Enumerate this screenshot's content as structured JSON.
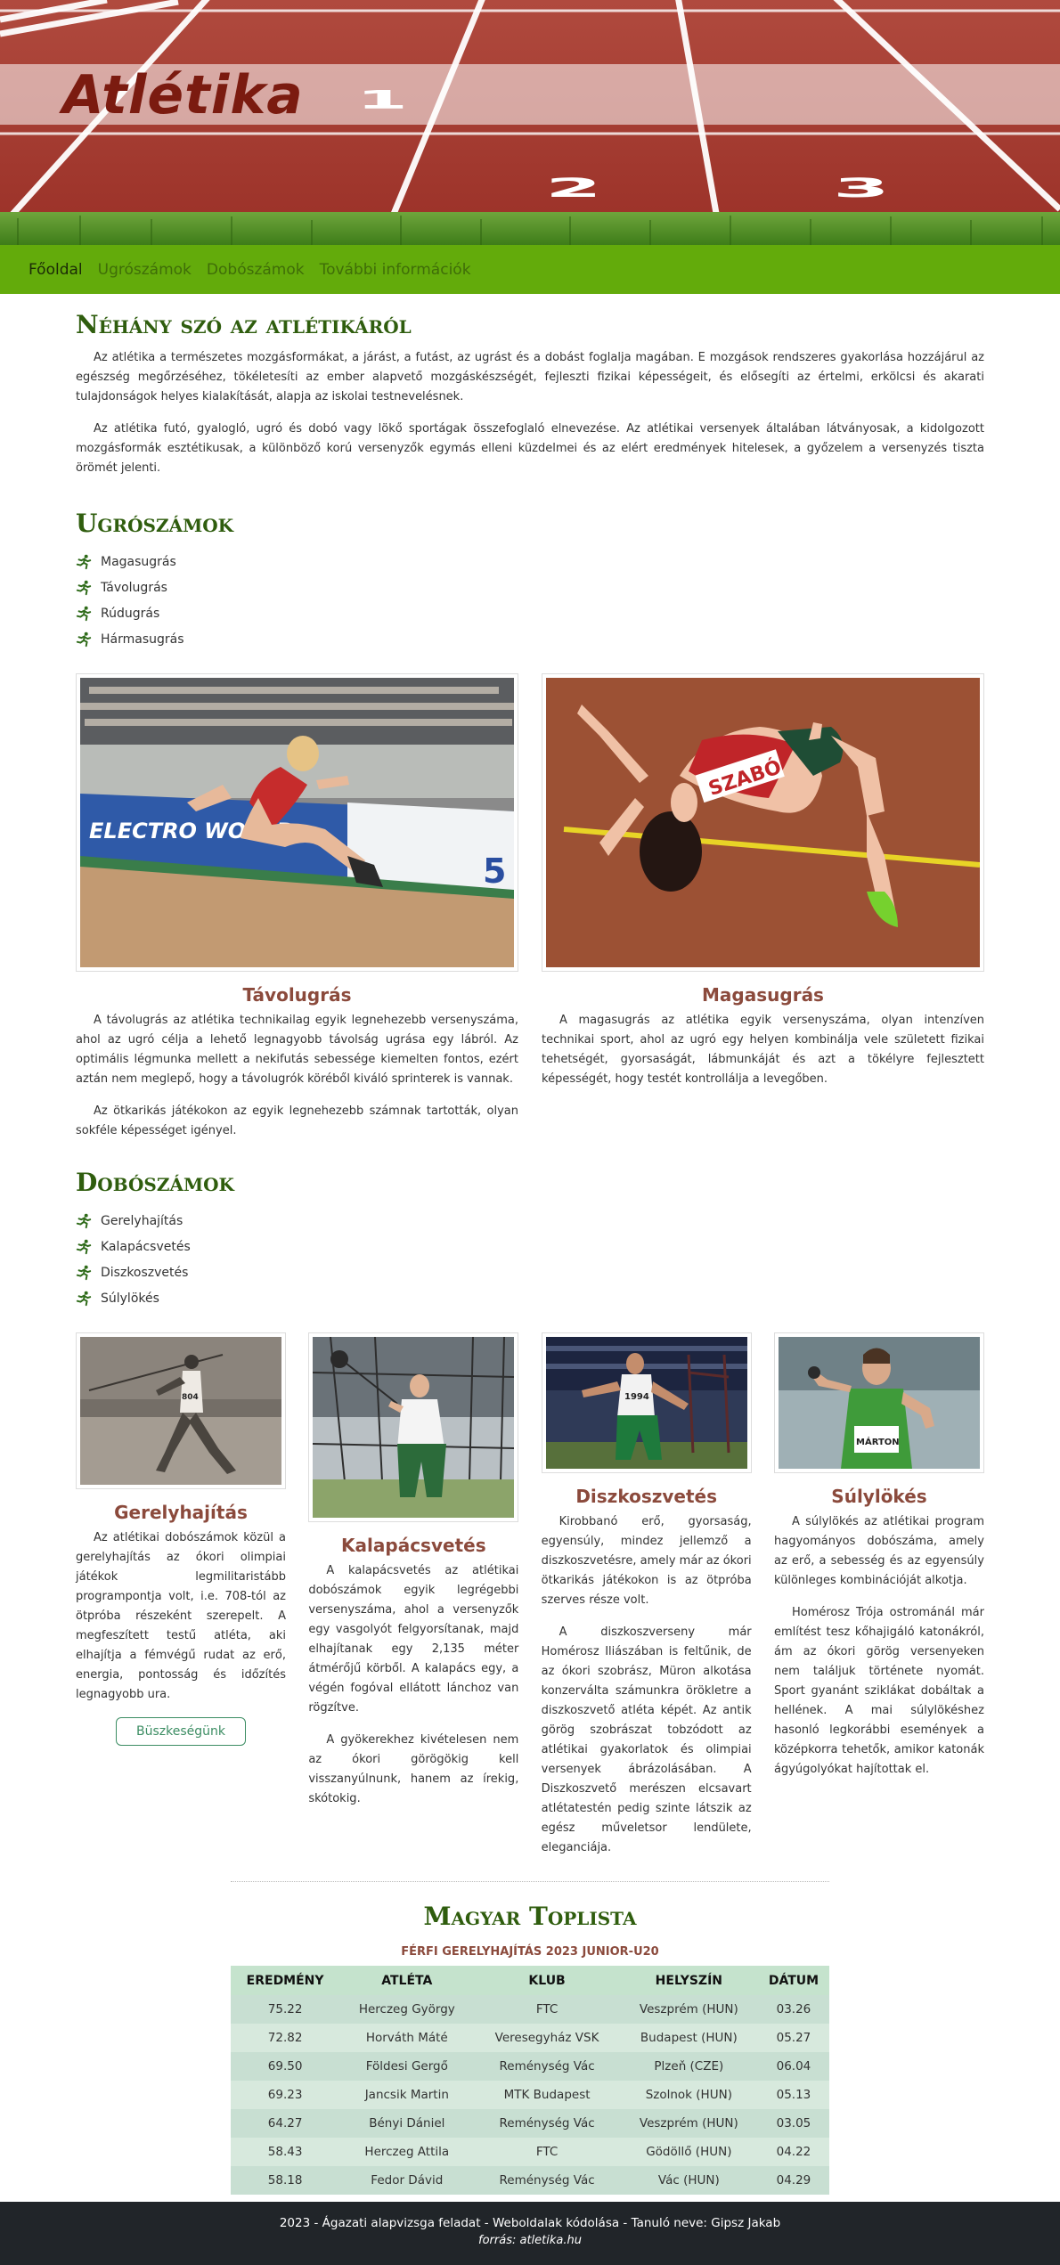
{
  "hero": {
    "title": "Atlétika",
    "lane_numbers": [
      "1",
      "2",
      "3"
    ]
  },
  "nav": {
    "items": [
      "Főoldal",
      "Ugrószámok",
      "Dobószámok",
      "További információk"
    ]
  },
  "intro": {
    "heading": "Néhány szó az atlétikáról",
    "p1": "Az atlétika a természetes mozgásformákat, a járást, a futást, az ugrást és a dobást foglalja magában. E mozgások rendszeres gyakorlása hozzájárul az egészség megőrzéséhez, tökéletesíti az ember alapvető mozgáskészségét, fejleszti fizikai képességeit, és elősegíti az értelmi, erkölcsi és akarati tulajdonságok helyes kialakítását, alapja az iskolai testnevelésnek.",
    "p2": "Az atlétika futó, gyalogló, ugró és dobó vagy lökő sportágak összefoglaló elnevezése. Az atlétikai versenyek általában látványosak, a kidolgozott mozgásformák esztétikusak, a különböző korú versenyzők egymás elleni küzdelmei és az elért eredmények hitelesek, a győzelem a versenyzés tiszta örömét jelenti."
  },
  "jumps": {
    "heading": "Ugrószámok",
    "list": [
      "Magasugrás",
      "Távolugrás",
      "Rúdugrás",
      "Hármasugrás"
    ],
    "cards": [
      {
        "title": "Távolugrás",
        "paragraphs": [
          "A távolugrás az atlétika technikailag egyik legnehezebb versenyszáma, ahol az ugró célja a lehető legnagyobb távolság ugrása egy lábról. Az optimális légmunka mellett a nekifutás sebessége kiemelten fontos, ezért aztán nem meglepő, hogy a távolugrók köréből kiváló sprinterek is vannak.",
          "Az ötkarikás játékokon az egyik legnehezebb számnak tartották, olyan sokféle képességet igényel."
        ],
        "image_text": "ELECTRO WORLD"
      },
      {
        "title": "Magasugrás",
        "paragraphs": [
          "A magasugrás az atlétika egyik versenyszáma, olyan intenzíven technikai sport, ahol az ugró egy helyen kombinálja vele született fizikai tehetségét, gyorsaságát, lábmunkáját és azt a tökélyre fejlesztett képességét, hogy testét kontrollálja a levegőben."
        ],
        "image_text": "SZABÓ"
      }
    ]
  },
  "throws": {
    "heading": "Dobószámok",
    "list": [
      "Gerelyhajítás",
      "Kalapácsvetés",
      "Diszkoszvetés",
      "Súlylökés"
    ],
    "cards": [
      {
        "title": "Gerelyhajítás",
        "paragraphs": [
          "Az atlétikai dobószámok közül a gerelyhajítás az ókori olimpiai játékok legmilitaristább programpontja volt, i.e. 708-tól az ötpróba részeként szerepelt. A megfeszített testű atléta, aki elhajítja a fémvégű rudat az erő, energia, pontosság és időzítés legnagyobb ura."
        ],
        "button": "Büszkeségünk"
      },
      {
        "title": "Kalapácsvetés",
        "paragraphs": [
          "A kalapácsvetés az atlétikai dobószámok egyik legrégebbi versenyszáma, ahol a versenyzők egy vasgolyót felgyorsítanak, majd elhajítanak egy 2,135 méter átmérőjű körből. A kalapács egy, a végén fogóval ellátott lánchoz van rögzítve.",
          "A gyökerekhez kivételesen nem az ókori görögökig kell visszanyúlnunk, hanem az írekig, skótokig."
        ]
      },
      {
        "title": "Diszkoszvetés",
        "paragraphs": [
          "Kirobbanó erő, gyorsaság, egyensúly, mindez jellemző a diszkoszvetésre, amely már az ókori ötkarikás játékokon is az ötpróba szerves része volt.",
          "A diszkoszverseny már Homérosz Iliászában is feltűnik, de az ókori szobrász, Müron alkotása konzerválta számunkra örökletre a diszkoszvető atléta képét. Az antik görög szobrászat tobzódott az atlétikai gyakorlatok és olimpiai versenyek ábrázolásában. A Diszkoszvető merészen elcsavart atlétatestén pedig szinte látszik az egész műveletsor lendülete, eleganciája."
        ],
        "image_text": "1994"
      },
      {
        "title": "Súlylökés",
        "paragraphs": [
          "A súlylökés az atlétikai program hagyományos dobószáma, amely az erő, a sebesség és az egyensúly különleges kombinációját alkotja.",
          "Homérosz Trója ostrománál már említést tesz kőhajigáló katonákról, ám az ókori görög versenyeken nem találjuk története nyomát. Sport gyanánt sziklákat dobáltak a hellének. A mai súlylökéshez hasonló legkorábbi események a középkorra tehetők, amikor katonák ágyúgolyókat hajítottak el."
        ],
        "image_text": "MÁRTON"
      }
    ]
  },
  "toplista": {
    "heading": "Magyar Toplista",
    "subtitle": "FÉRFI GERELYHAJÍTÁS 2023 JUNIOR-U20",
    "columns": [
      "EREDMÉNY",
      "ATLÉTA",
      "KLUB",
      "HELYSZÍN",
      "DÁTUM"
    ],
    "rows": [
      [
        "75.22",
        "Herczeg György",
        "FTC",
        "Veszprém (HUN)",
        "03.26"
      ],
      [
        "72.82",
        "Horváth Máté",
        "Veresegyház VSK",
        "Budapest (HUN)",
        "05.27"
      ],
      [
        "69.50",
        "Földesi Gergő",
        "Reménység Vác",
        "Plzeň (CZE)",
        "06.04"
      ],
      [
        "69.23",
        "Jancsik Martin",
        "MTK Budapest",
        "Szolnok (HUN)",
        "05.13"
      ],
      [
        "64.27",
        "Bényi Dániel",
        "Reménység Vác",
        "Veszprém (HUN)",
        "03.05"
      ],
      [
        "58.43",
        "Herczeg Attila",
        "FTC",
        "Gödöllő (HUN)",
        "04.22"
      ],
      [
        "58.18",
        "Fedor Dávid",
        "Reménység Vác",
        "Vác (HUN)",
        "04.29"
      ]
    ]
  },
  "footer": {
    "line1": "2023 - Ágazati alapvizsga feladat - Weboldalak kódolása - Tanuló neve: Gipsz Jakab",
    "line2": "forrás: atletika.hu"
  },
  "colors": {
    "nav_bg": "#63ab0b",
    "heading": "#2f5d0e",
    "card_title": "#8b4a3c",
    "track": "#9e3a30",
    "footer_bg": "#212529"
  }
}
